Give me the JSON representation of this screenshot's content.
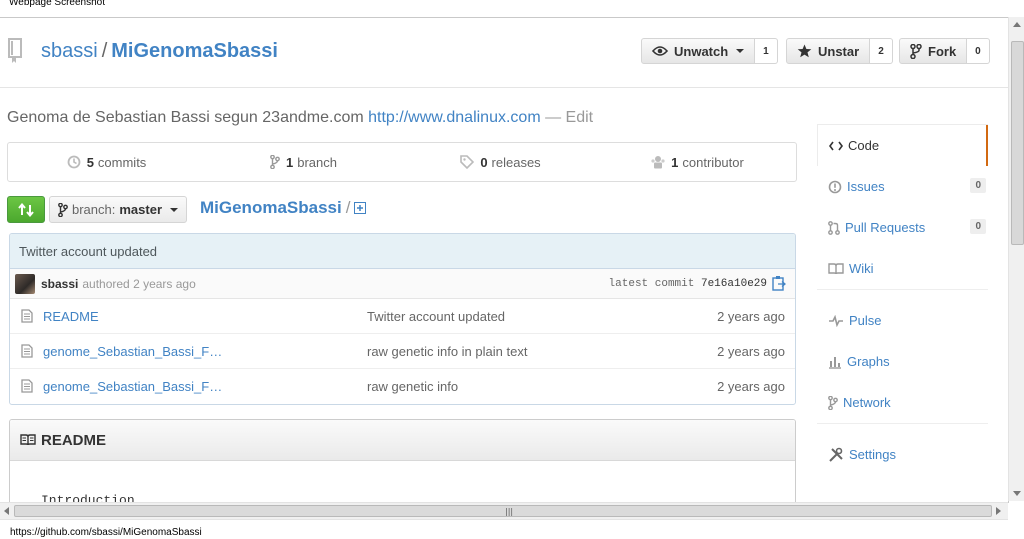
{
  "captions": {
    "top": "Webpage Screenshot",
    "status_url": "https://github.com/sbassi/MiGenomaSbassi"
  },
  "repo": {
    "owner": "sbassi",
    "separator": "/",
    "name": "MiGenomaSbassi",
    "description": "Genoma de Sebastian Bassi segun 23andme.com",
    "website": "http://www.dnalinux.com",
    "edit_label": "— Edit"
  },
  "actions": {
    "watch": {
      "label": "Unwatch",
      "count": "1",
      "icon": "eye-icon"
    },
    "star": {
      "label": "Unstar",
      "count": "2",
      "icon": "star-icon"
    },
    "fork": {
      "label": "Fork",
      "count": "0",
      "icon": "fork-icon"
    }
  },
  "summary": [
    {
      "count": "5",
      "label": "commits",
      "icon": "history-icon"
    },
    {
      "count": "1",
      "label": "branch",
      "icon": "branch-icon"
    },
    {
      "count": "0",
      "label": "releases",
      "icon": "tag-icon"
    },
    {
      "count": "1",
      "label": "contributor",
      "icon": "organization-icon"
    }
  ],
  "branch": {
    "prefix": "branch:",
    "name": "master"
  },
  "breadcrumb": {
    "repo": "MiGenomaSbassi",
    "slash": "/"
  },
  "commit": {
    "message": "Twitter account updated",
    "author": "sbassi",
    "action": "authored 2 years ago",
    "latest_label": "latest commit",
    "sha": "7e16a10e29"
  },
  "files": [
    {
      "name": "README",
      "message": "Twitter account updated",
      "age": "2 years ago"
    },
    {
      "name": "genome_Sebastian_Bassi_F…",
      "message": "raw genetic info in plain text",
      "age": "2 years ago"
    },
    {
      "name": "genome_Sebastian_Bassi_F…",
      "message": "raw genetic info",
      "age": "2 years ago"
    }
  ],
  "readme": {
    "title": "README",
    "first_line": "Introduction"
  },
  "sidebar": [
    {
      "label": "Code",
      "count": "",
      "icon": "code-icon",
      "selected": true
    },
    {
      "label": "Issues",
      "count": "0",
      "icon": "issue-icon"
    },
    {
      "label": "Pull Requests",
      "count": "0",
      "icon": "pull-request-icon"
    },
    {
      "label": "Wiki",
      "count": "",
      "icon": "book-icon"
    },
    {
      "label": "Pulse",
      "count": "",
      "icon": "pulse-icon"
    },
    {
      "label": "Graphs",
      "count": "",
      "icon": "graph-icon"
    },
    {
      "label": "Network",
      "count": "",
      "icon": "network-icon"
    },
    {
      "label": "Settings",
      "count": "",
      "icon": "tools-icon"
    }
  ],
  "colors": {
    "link": "#4183c4",
    "accent_selected": "#d26911",
    "compare_green": "#6cc644"
  }
}
